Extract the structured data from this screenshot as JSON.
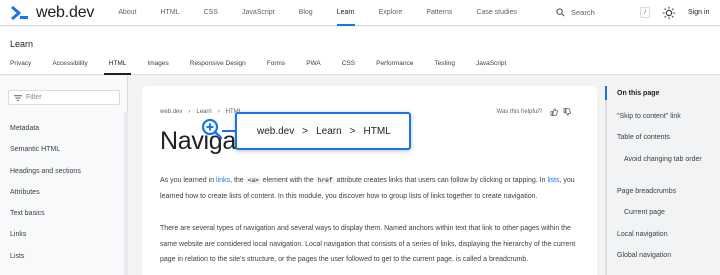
{
  "header": {
    "logo_text": "web.dev",
    "nav": [
      "About",
      "HTML",
      "CSS",
      "JavaScript",
      "Blog",
      "Learn",
      "Explore",
      "Patterns",
      "Case studies"
    ],
    "active_nav": "Learn",
    "search_placeholder": "Search",
    "search_shortcut": "/",
    "signin_label": "Sign in"
  },
  "section": {
    "title": "Learn",
    "tabs": [
      "Privacy",
      "Accessibility",
      "HTML",
      "Images",
      "Responsive Design",
      "Forms",
      "PWA",
      "CSS",
      "Performance",
      "Testing",
      "JavaScript"
    ],
    "active_tab": "HTML"
  },
  "sidebar": {
    "filter_placeholder": "Filter",
    "items": [
      "Metadata",
      "Semantic HTML",
      "Headings and sections",
      "Attributes",
      "Text basics",
      "Links",
      "Lists"
    ]
  },
  "main": {
    "breadcrumb": [
      "web.dev",
      "Learn",
      "HTML"
    ],
    "helpful_label": "Was this helpful?",
    "title": "Navigation",
    "p1": {
      "a": "As you learned in ",
      "link1": "links",
      "b": ", the ",
      "code1": "<a>",
      "c": " element with the ",
      "code2": "href",
      "d": " attribute creates links that users can follow by clicking or tapping. In ",
      "link2": "lists",
      "e": ", you learned how to create lists of content. In this module, you discover how to group lists of links together to create navigation."
    },
    "p2": "There are several types of navigation and several ways to display them. Named anchors within text that link to other pages within the same website are considered local navigation. Local navigation that consists of a series of links, displaying the hierarchy of the current page in relation to the site's structure, or the pages the user followed to get to the current page, is called a breadcrumb."
  },
  "toc": {
    "heading": "On this page",
    "items": [
      "\"Skip to content\" link",
      "Table of contents",
      "Avoid changing tab order",
      "Page breadcrumbs",
      "Current page",
      "Local navigation",
      "Global navigation"
    ]
  },
  "callout": {
    "items": [
      "web.dev",
      "Learn",
      "HTML"
    ],
    "separator": ">"
  },
  "colors": {
    "accent": "#1a73e8",
    "text": "#202124",
    "muted": "#5f6368"
  }
}
